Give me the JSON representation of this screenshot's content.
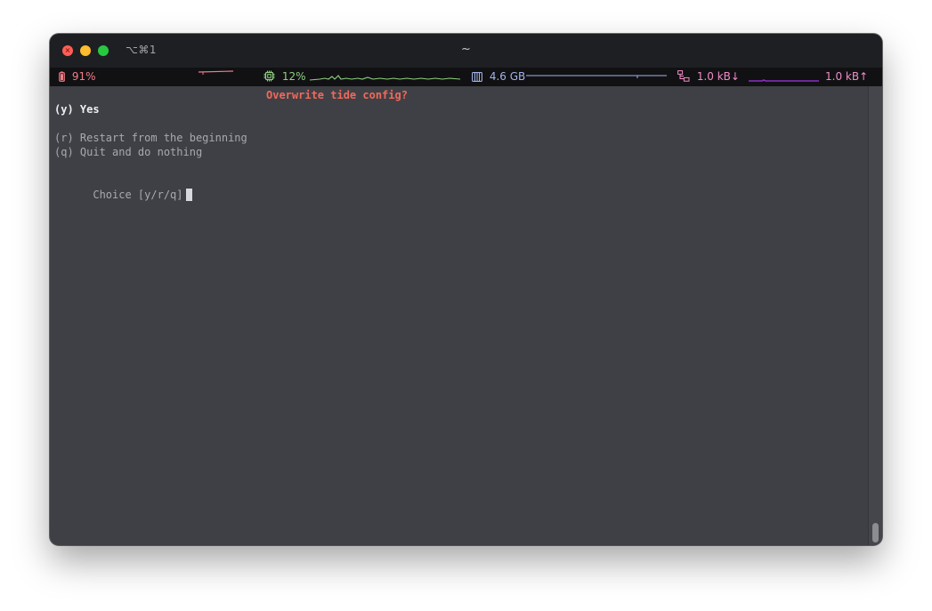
{
  "window": {
    "shortcut": "⌥⌘1",
    "title": "~"
  },
  "statusbar": {
    "battery": {
      "icon": "battery-icon",
      "value": "91%",
      "color": "#f07d86"
    },
    "cpu": {
      "icon": "cpu-icon",
      "value": "12%",
      "color": "#8fd07f"
    },
    "memory": {
      "icon": "memory-icon",
      "value": "4.6 GB",
      "color": "#a2b3e6"
    },
    "network": {
      "icon": "network-icon",
      "down": "1.0 kB↓",
      "up": "1.0 kB↑",
      "color": "#f08cc6",
      "graph_color": "#8c2fc9"
    }
  },
  "terminal": {
    "prompt_title": "Overwrite tide config?",
    "option_yes": "(y) Yes",
    "option_restart": "(r) Restart from the beginning",
    "option_quit": "(q) Quit and do nothing",
    "choice_prompt": "Choice [y/r/q]"
  }
}
